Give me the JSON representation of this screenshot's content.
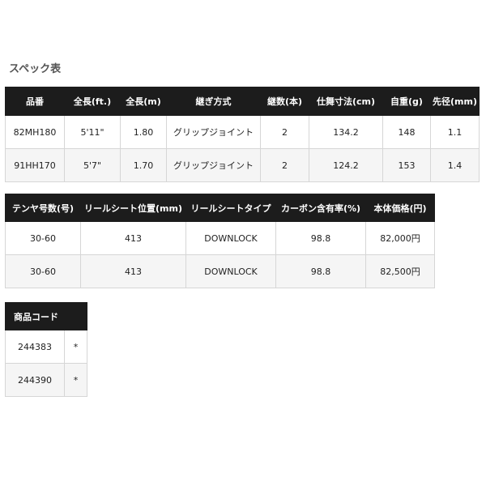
{
  "title": "スペック表",
  "table1": {
    "headers": [
      "品番",
      "全長(ft.)",
      "全長(m)",
      "継ぎ方式",
      "継数(本)",
      "仕舞寸法(cm)",
      "自重(g)",
      "先径(mm)"
    ],
    "rows": [
      [
        "82MH180",
        "5'11\"",
        "1.80",
        "グリップジョイント",
        "2",
        "134.2",
        "148",
        "1.1"
      ],
      [
        "91HH170",
        "5'7\"",
        "1.70",
        "グリップジョイント",
        "2",
        "124.2",
        "153",
        "1.4"
      ]
    ]
  },
  "table2": {
    "headers": [
      "テンヤ号数(号)",
      "リールシート位置(mm)",
      "リールシートタイプ",
      "カーボン含有率(%)",
      "本体価格(円)"
    ],
    "rows": [
      [
        "30-60",
        "413",
        "DOWNLOCK",
        "98.8",
        "82,000円"
      ],
      [
        "30-60",
        "413",
        "DOWNLOCK",
        "98.8",
        "82,500円"
      ]
    ]
  },
  "table3": {
    "headers": [
      "商品コード"
    ],
    "rows": [
      [
        "244383",
        "*"
      ],
      [
        "244390",
        "*"
      ]
    ]
  }
}
